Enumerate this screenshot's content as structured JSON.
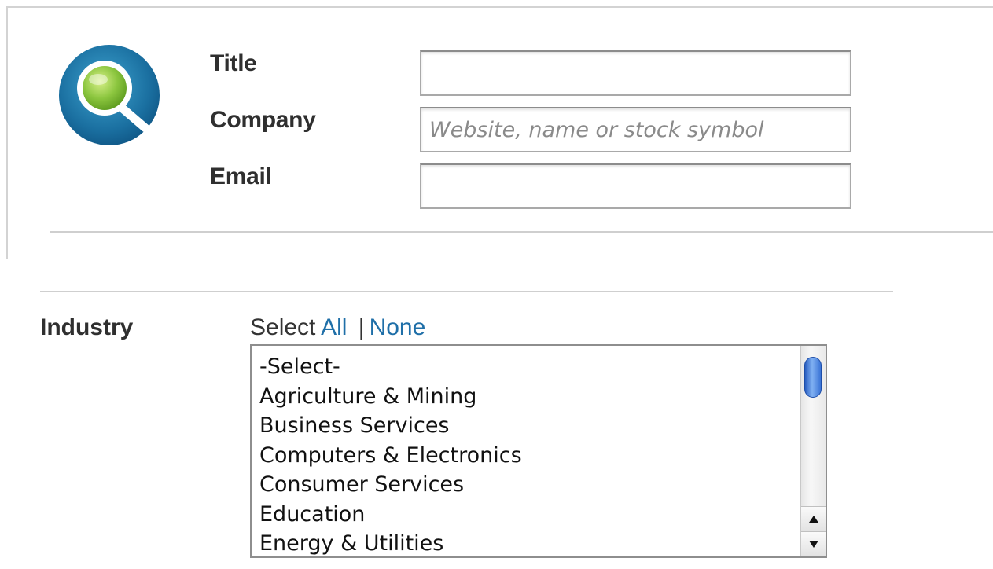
{
  "contact_form": {
    "logo_icon": "magnifier-search-icon",
    "fields": {
      "title": {
        "label": "Title",
        "value": "",
        "placeholder": ""
      },
      "company": {
        "label": "Company",
        "value": "",
        "placeholder": "Website, name or stock symbol"
      },
      "email": {
        "label": "Email",
        "value": "",
        "placeholder": ""
      }
    }
  },
  "industry": {
    "label": "Industry",
    "select_prefix": "Select",
    "select_all": "All",
    "separator": "|",
    "select_none": "None",
    "options": [
      "-Select-",
      "Agriculture & Mining",
      "Business Services",
      "Computers & Electronics",
      "Consumer Services",
      "Education",
      "Energy & Utilities"
    ]
  },
  "colors": {
    "link": "#1f6fa8",
    "logo_blue": "#1a6fa0",
    "logo_green": "#8cc63f",
    "scroll_thumb": "#3b74d6"
  }
}
